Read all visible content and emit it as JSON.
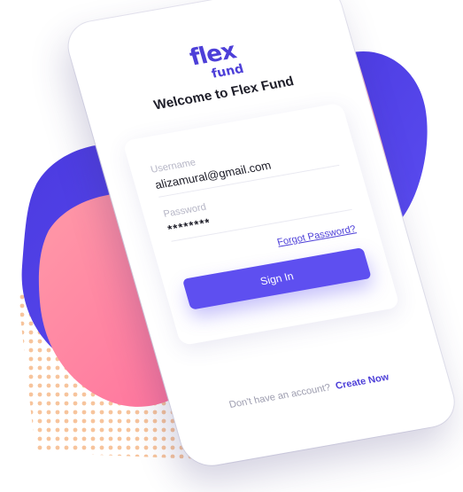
{
  "colors": {
    "brand_purple": "#5e4ff0",
    "brand_pink": "#ff7fa3",
    "dot_orange": "#f6b98a"
  },
  "logo": {
    "line1": "flex",
    "line2": "fund"
  },
  "welcome_title": "Welcome to Flex Fund",
  "form": {
    "username": {
      "label": "Username",
      "value": "alizamural@gmail.com"
    },
    "password": {
      "label": "Password",
      "value": "********"
    },
    "forgot_link": "Forgot Password?",
    "signin_button": "Sign In"
  },
  "signup": {
    "prompt": "Don't have an account?",
    "link": "Create Now"
  }
}
